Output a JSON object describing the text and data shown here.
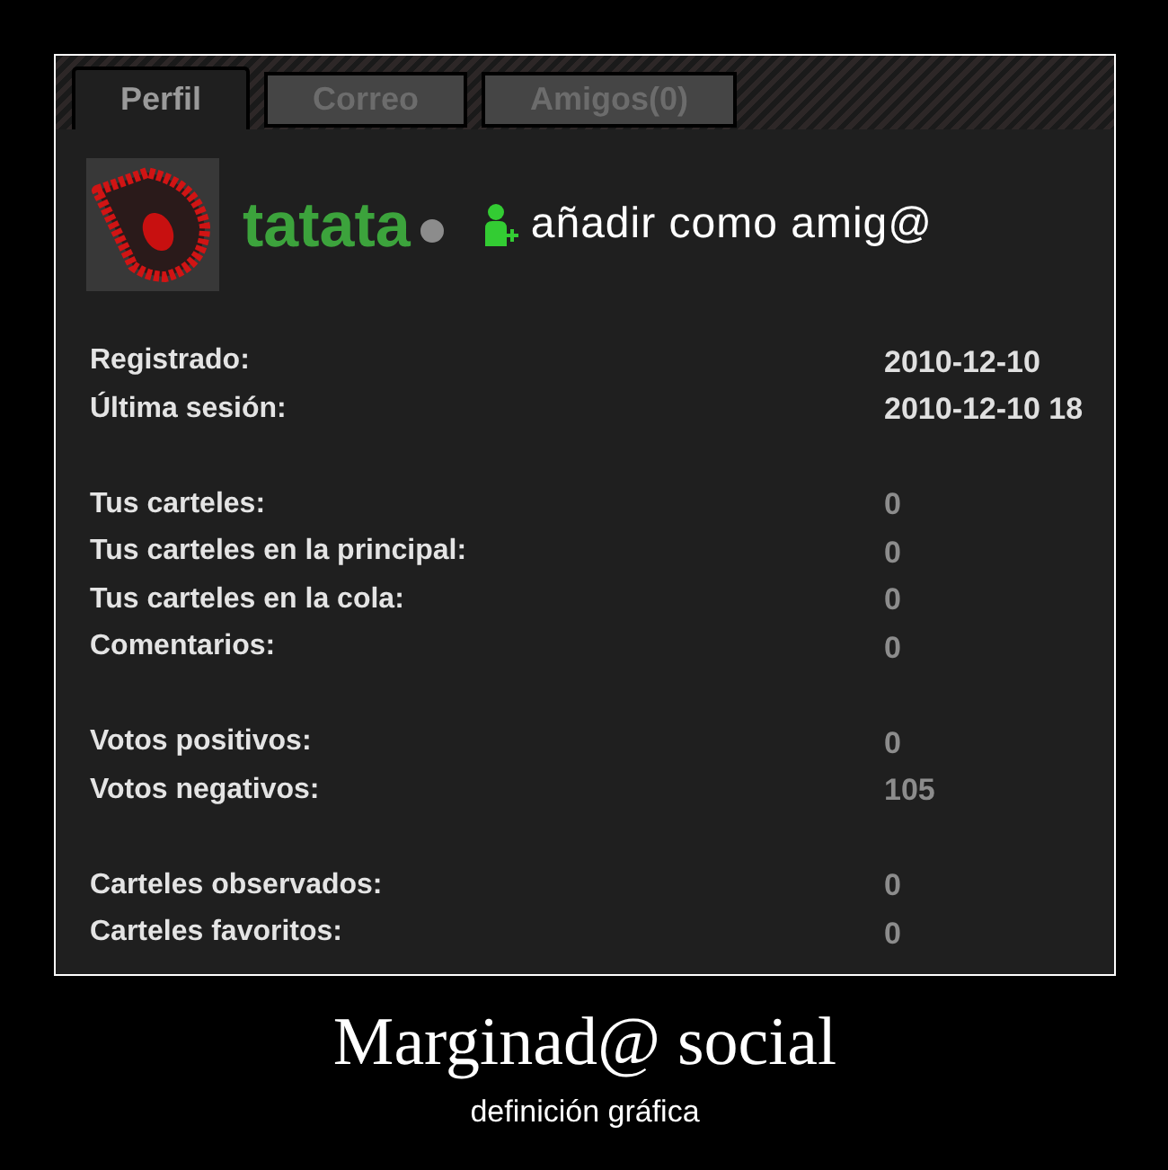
{
  "tabs": [
    {
      "label": "Perfil",
      "selected": true
    },
    {
      "label": "Correo",
      "selected": false
    },
    {
      "label": "Amigos(0)",
      "selected": false
    }
  ],
  "profile": {
    "username": "tatata",
    "online": false,
    "add_friend_link": "añadir como amig@"
  },
  "stat_groups": [
    {
      "rows": [
        {
          "label": "Registrado:",
          "value": "2010-12-10",
          "kind": "date"
        },
        {
          "label": "Última sesión:",
          "value": "2010-12-10 18",
          "kind": "date"
        }
      ]
    },
    {
      "rows": [
        {
          "label": "Tus carteles:",
          "value": "0",
          "kind": "count"
        },
        {
          "label": "Tus carteles en la principal:",
          "value": "0",
          "kind": "count"
        },
        {
          "label": "Tus carteles en la cola:",
          "value": "0",
          "kind": "count"
        },
        {
          "label": "Comentarios:",
          "value": "0",
          "kind": "count"
        }
      ]
    },
    {
      "rows": [
        {
          "label": "Votos positivos:",
          "value": "0",
          "kind": "count"
        },
        {
          "label": "Votos negativos:",
          "value": "105",
          "kind": "count"
        }
      ]
    },
    {
      "rows": [
        {
          "label": "Carteles observados:",
          "value": "0",
          "kind": "count"
        },
        {
          "label": "Carteles favoritos:",
          "value": "0",
          "kind": "count"
        }
      ]
    }
  ],
  "caption": {
    "title": "Marginad@ social",
    "subtitle": "definición gráfica"
  }
}
